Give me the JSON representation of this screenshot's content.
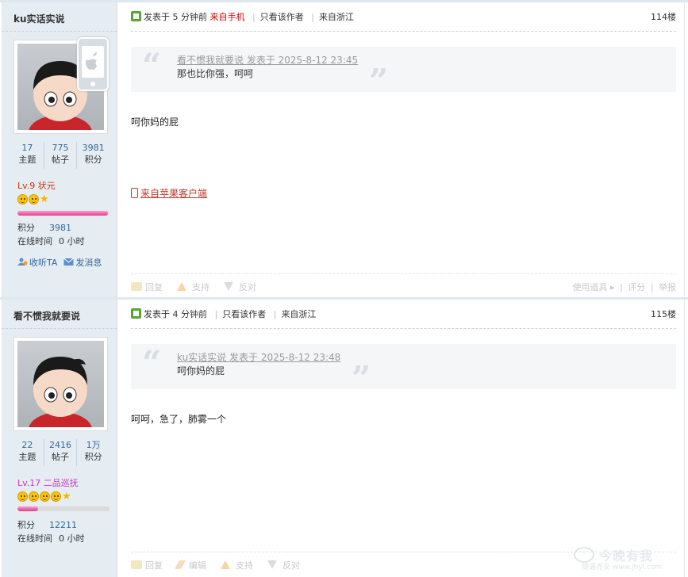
{
  "posts": [
    {
      "author": {
        "name": "ku实话实说",
        "device_badge": "apple-iphone-icon",
        "stats": [
          {
            "value": "17",
            "label": "主题"
          },
          {
            "value": "775",
            "label": "帖子"
          },
          {
            "value": "3981",
            "label": "积分"
          }
        ],
        "level": "Lv.9 状元",
        "level_color": "#cc3300",
        "progress": 0.98,
        "credits_label": "积分",
        "credits_value": "3981",
        "online_label": "在线时间",
        "online_value": "0 小时",
        "actions": {
          "follow": "收听TA",
          "message": "发消息"
        }
      },
      "header": {
        "posted_prefix": "发表于 5 分钟前",
        "from_mobile": "来自手机",
        "only_author": "只看该作者",
        "location": "来自浙江",
        "floor": "114楼"
      },
      "quote": {
        "who": "看不惯我就要说 发表于 2025-8-12 23:45",
        "text": "那也比你强，呵呵"
      },
      "body": "呵你妈的屁",
      "client_link": "来自苹果客户端",
      "footer": {
        "reply": "回复",
        "support": "支持",
        "oppose": "反对",
        "use_tool": "使用道具 ▸",
        "rate": "评分",
        "report": "举报"
      }
    },
    {
      "author": {
        "name": "看不惯我就要说",
        "stats": [
          {
            "value": "22",
            "label": "主题"
          },
          {
            "value": "2416",
            "label": "帖子"
          },
          {
            "value": "1万",
            "label": "积分"
          }
        ],
        "level": "Lv.17 二品巡抚",
        "level_color": "#cc33cc",
        "progress": 0.22,
        "credits_label": "积分",
        "credits_value": "12211",
        "online_label": "在线时间",
        "online_value": "0 小时"
      },
      "header": {
        "posted_prefix": "发表于 4 分钟前",
        "only_author": "只看该作者",
        "location": "来自浙江",
        "floor": "115楼"
      },
      "quote": {
        "who": "ku实话实说 发表于 2025-8-12 23:48",
        "text": "呵你妈的屁"
      },
      "body": "呵呵，急了，肺雾一个",
      "footer": {
        "reply": "回复",
        "edit": "编辑",
        "support": "支持",
        "oppose": "反对"
      }
    }
  ],
  "watermark": {
    "title": "今晚有我",
    "sub": "随遇而安 www.jhyl.com"
  }
}
